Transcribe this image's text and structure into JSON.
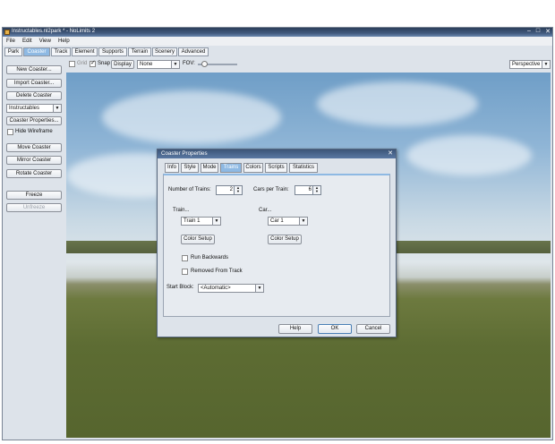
{
  "window": {
    "title": "Instructables.nl2park * - NoLimits 2",
    "buttons": [
      "–",
      "□",
      "✕"
    ]
  },
  "menu": [
    "File",
    "Edit",
    "View",
    "Help"
  ],
  "tabs": [
    "Park",
    "Coaster",
    "Track",
    "Element",
    "Supports",
    "Terrain",
    "Scenery",
    "Advanced"
  ],
  "active_tab": "Coaster",
  "toolbar": {
    "grid_label": "Grid",
    "snap_label": "Snap",
    "display_label": "Display",
    "none_select": "None",
    "fov_label": "FOV:",
    "view_select": "Perspective",
    "fov_level": 0.1
  },
  "sidebar": {
    "new_coaster": "New Coaster...",
    "import_coaster": "Import Coaster...",
    "delete_coaster": "Delete Coaster",
    "coaster_select": "Instructables",
    "coaster_properties": "Coaster Properties...",
    "hide_wireframe": "Hide Wireframe",
    "move_coaster": "Move Coaster",
    "mirror_coaster": "Mirror Coaster",
    "rotate_coaster": "Rotate Coaster",
    "freeze": "Freeze",
    "unfreeze": "Unfreeze"
  },
  "dialog": {
    "title": "Coaster Properties",
    "tabs": [
      "Info",
      "Style",
      "Mode",
      "Trains",
      "Colors",
      "Scripts",
      "Statistics"
    ],
    "active_tab": "Trains",
    "num_trains_label": "Number of Trains:",
    "num_trains_value": "2",
    "cars_per_train_label": "Cars per Train:",
    "cars_per_train_value": "6",
    "train_group": "Train...",
    "car_group": "Car...",
    "train_select": "Train 1",
    "car_select": "Car 1",
    "train_color_setup": "Color Setup",
    "car_color_setup": "Color Setup",
    "run_backwards": "Run Backwards",
    "removed_from_track": "Removed From Track",
    "start_block_label": "Start Block:",
    "start_block_value": "<Automatic>",
    "help": "Help",
    "ok": "OK",
    "cancel": "Cancel"
  }
}
